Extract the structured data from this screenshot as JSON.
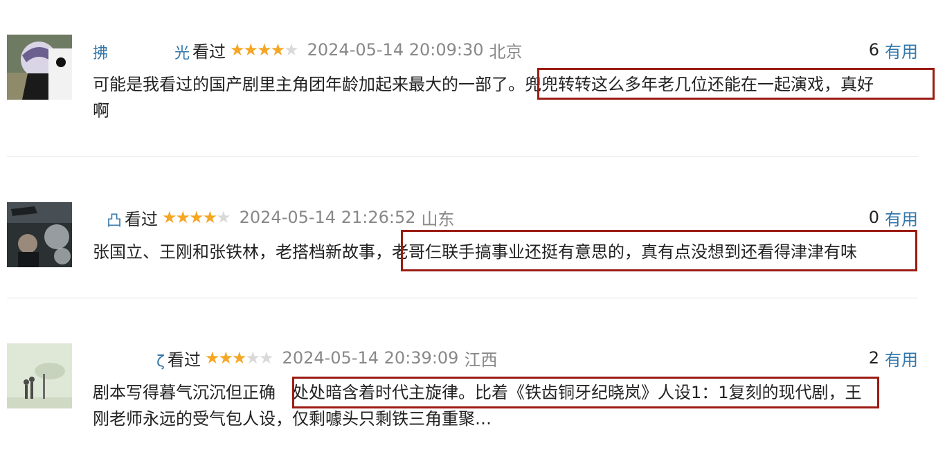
{
  "reviews": [
    {
      "username": "拂",
      "username_tail": "光",
      "watched_label": "看过",
      "rating": 4,
      "max_rating": 5,
      "time": "2024-05-14 20:09:30",
      "location": "北京",
      "useful_count": "6",
      "useful_label": "有用",
      "line1_a": "可能是我看过的国产剧里主角团年龄加起来最大的一部了。",
      "line1_b": "兜兜转转这么多年老几位还能在一起演戏，真好",
      "line2": "啊"
    },
    {
      "username": "",
      "username_tail": "凸",
      "watched_label": "看过",
      "rating": 4,
      "max_rating": 5,
      "time": "2024-05-14 21:26:52",
      "location": "山东",
      "useful_count": "0",
      "useful_label": "有用",
      "line1_a": "张国立、王刚和张铁林，老搭档新故事，",
      "line1_b": "老哥仨联手搞事业还挺有意思的，真有点没想到还看得津津有味",
      "line2": ""
    },
    {
      "username": "",
      "username_tail": "ζ",
      "watched_label": "看过",
      "rating": 3,
      "max_rating": 5,
      "time": "2024-05-14 20:39:09",
      "location": "江西",
      "useful_count": "2",
      "useful_label": "有用",
      "line1_a": "剧本写得暮气沉沉但正确",
      "line1_b": "处处暗含着时代主旋律。比着《铁齿铜牙纪晓岚》人设1：1复刻的现代剧",
      "line1_c": "，王",
      "line2": "刚老师永远的受气包人设，仅剩噱头只剩铁三角重聚…"
    }
  ],
  "colors": {
    "link": "#3377aa",
    "star_on": "#f5a623",
    "star_off": "#d9d9d9",
    "highlight": "#9b1b12"
  }
}
